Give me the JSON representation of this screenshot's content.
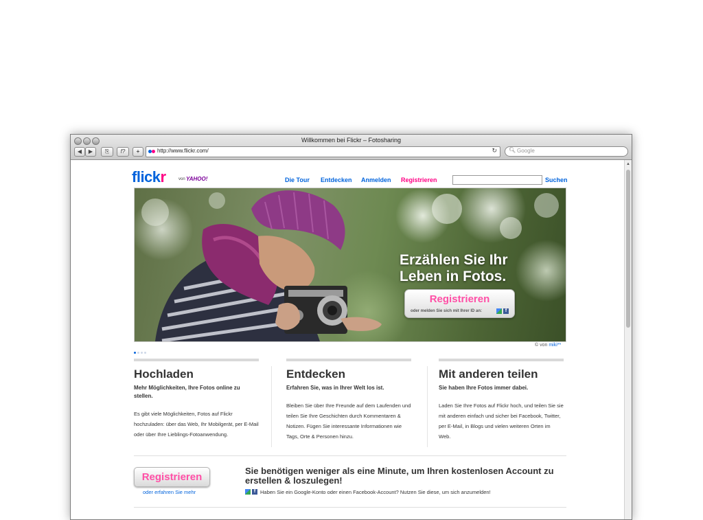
{
  "window": {
    "title": "Willkommen bei Flickr – Fotosharing",
    "url": "http://www.flickr.com/",
    "search_placeholder": "Google",
    "back_label": "◀",
    "forward_label": "▶",
    "bookmark_label": "⎘",
    "snapback_label": "f?",
    "add_label": "+",
    "reload_label": "↻"
  },
  "header": {
    "logo_main": "flick",
    "logo_r": "r",
    "logo_von": "von",
    "logo_yahoo": "YAHOO!",
    "nav": [
      "Die Tour",
      "Entdecken",
      "Anmelden",
      "Registrieren"
    ],
    "search_button": "Suchen"
  },
  "hero": {
    "headline": "Erzählen Sie Ihr Leben in Fotos.",
    "cta_label": "Registrieren",
    "cta_sub": "oder melden Sie sich mit Ihrer ID an:",
    "credit_prefix": "© von",
    "credit_author": "miki**"
  },
  "columns": [
    {
      "title": "Hochladen",
      "subtitle": "Mehr Möglichkeiten, Ihre Fotos online zu stellen.",
      "body": "Es gibt viele Möglichkeiten, Fotos auf Flickr hochzuladen: über das Web, Ihr Mobilgerät, per E-Mail oder über Ihre Lieblings-Fotoanwendung."
    },
    {
      "title": "Entdecken",
      "subtitle": "Erfahren Sie, was in Ihrer Welt los ist.",
      "body": "Bleiben Sie über Ihre Freunde auf dem Laufenden und teilen Sie Ihre Geschichten durch Kommentaren & Notizen. Fügen Sie interessante Informationen wie Tags, Orte & Personen hinzu."
    },
    {
      "title": "Mit anderen teilen",
      "subtitle": "Sie haben Ihre Fotos immer dabei.",
      "body": "Laden Sie Ihre Fotos auf Flickr hoch, und teilen Sie sie mit anderen einfach und sicher bei Facebook, Twitter, per E-Mail, in Blogs und vielen weiteren Orten im Web."
    }
  ],
  "signup": {
    "button": "Registrieren",
    "learn_more": "oder erfahren Sie mehr",
    "headline": "Sie benötigen weniger als eine Minute, um Ihren kostenlosen Account zu erstellen & loszulegen!",
    "note": "Haben Sie ein Google-Konto oder einen Facebook-Account? Nutzen Sie diese, um sich anzumelden!",
    "facebook_glyph": "f"
  },
  "colors": {
    "brand_blue": "#0063dc",
    "brand_pink": "#ff0084"
  },
  "slideshow": {
    "slides": 4,
    "active": 1
  }
}
